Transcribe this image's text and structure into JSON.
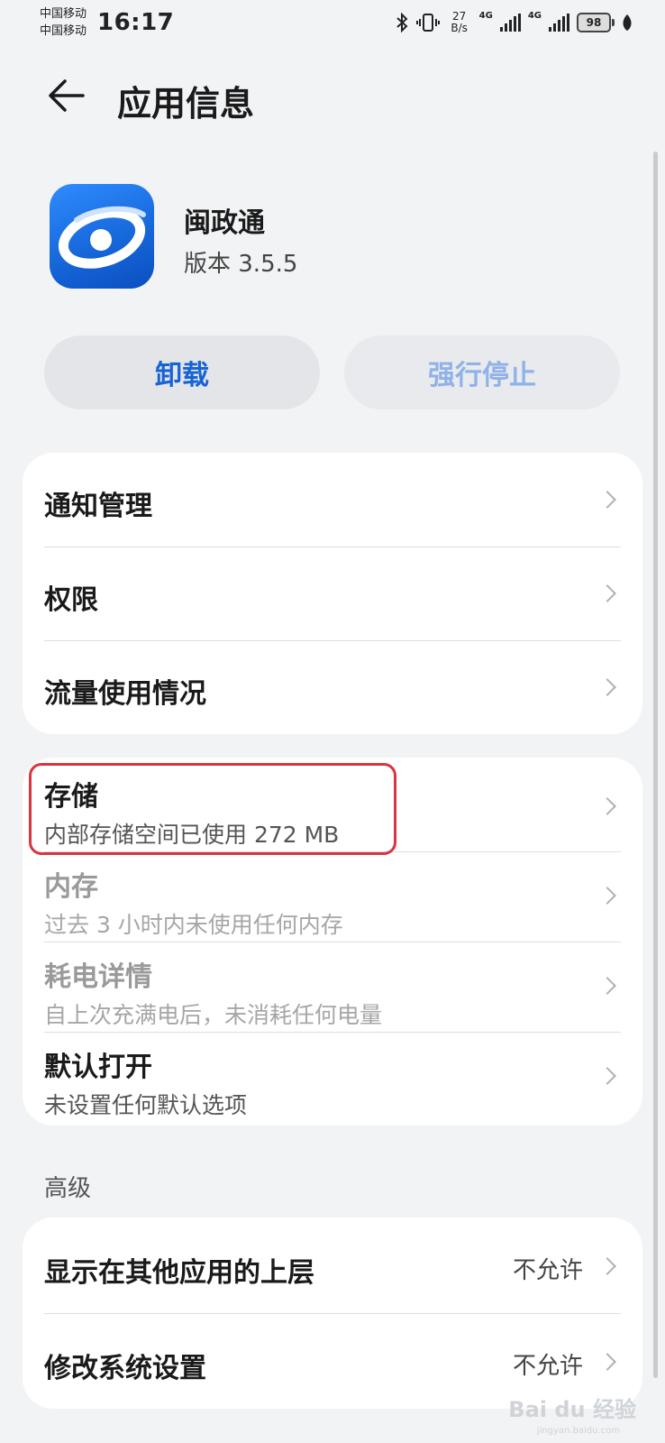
{
  "status_bar": {
    "carrier_1": "中国移动",
    "carrier_2": "中国移动",
    "time": "16:17",
    "net_speed_value": "27",
    "net_speed_unit": "B/s",
    "network_1": "4G",
    "network_2": "4G",
    "battery": "98"
  },
  "header": {
    "title": "应用信息"
  },
  "app": {
    "name": "闽政通",
    "version": "版本 3.5.5",
    "icon": "minzhengtong-app-icon"
  },
  "actions": {
    "uninstall": "卸载",
    "force_stop": "强行停止"
  },
  "group1": [
    {
      "title": "通知管理"
    },
    {
      "title": "权限"
    },
    {
      "title": "流量使用情况"
    }
  ],
  "group2": [
    {
      "title": "存储",
      "subtitle": "内部存储空间已使用 272 MB",
      "enabled": true
    },
    {
      "title": "内存",
      "subtitle": "过去 3 小时内未使用任何内存",
      "enabled": false
    },
    {
      "title": "耗电详情",
      "subtitle": "自上次充满电后，未消耗任何电量",
      "enabled": false
    },
    {
      "title": "默认打开",
      "subtitle": "未设置任何默认选项",
      "enabled": true
    }
  ],
  "advanced": {
    "label": "高级",
    "items": [
      {
        "title": "显示在其他应用的上层",
        "value": "不允许"
      },
      {
        "title": "修改系统设置",
        "value": "不允许"
      }
    ]
  },
  "watermark": {
    "text": "Bai du 经验",
    "sub": "jingyan.baidu.com"
  },
  "colors": {
    "accent": "#1763d6",
    "highlight": "#d9343f",
    "background": "#f1f3f5"
  }
}
